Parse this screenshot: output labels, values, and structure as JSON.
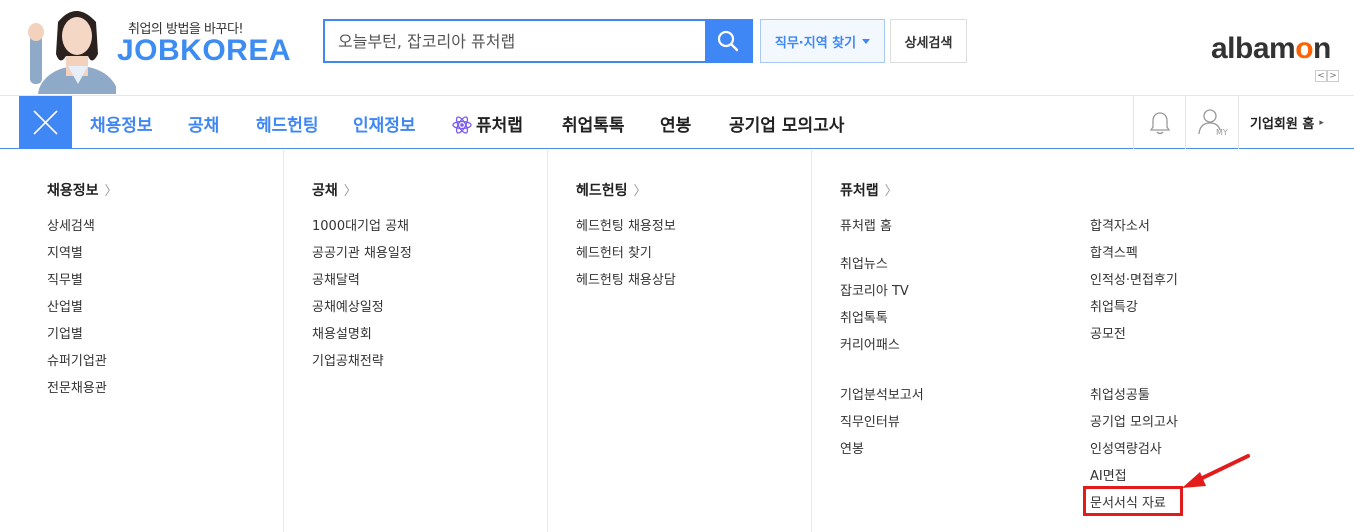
{
  "header": {
    "tagline": "취업의 방법을 바꾸다!",
    "logo": "JOBKOREA",
    "search_placeholder": "오늘부턴, 잡코리아 퓨처랩",
    "job_region_button": "직무·지역 찾기",
    "detail_search_button": "상세검색",
    "partner_logo_a": "albam",
    "partner_logo_b": "n",
    "slide_prev": "<",
    "slide_next": ">"
  },
  "nav": {
    "items": [
      "채용정보",
      "공채",
      "헤드헌팅",
      "인재정보",
      "퓨처랩",
      "취업톡톡",
      "연봉",
      "공기업 모의고사"
    ],
    "corp_home": "기업회원 홈",
    "my_label": "MY"
  },
  "menu": {
    "recruit": {
      "title": "채용정보",
      "links": [
        "상세검색",
        "지역별",
        "직무별",
        "산업별",
        "기업별",
        "슈퍼기업관",
        "전문채용관"
      ]
    },
    "public": {
      "title": "공채",
      "links": [
        "1000대기업 공채",
        "공공기관 채용일정",
        "공채달력",
        "공채예상일정",
        "채용설명회",
        "기업공채전략"
      ]
    },
    "headhunting": {
      "title": "헤드헌팅",
      "links": [
        "헤드헌팅 채용정보",
        "헤드헌터 찾기",
        "헤드헌팅 채용상담"
      ]
    },
    "futurelab": {
      "title": "퓨처랩",
      "left_links": [
        "퓨처랩 홈",
        "취업뉴스",
        "잡코리아 TV",
        "취업톡톡",
        "커리어패스",
        "기업분석보고서",
        "직무인터뷰",
        "연봉"
      ],
      "right_links": [
        "합격자소서",
        "합격스펙",
        "인적성·면접후기",
        "취업특강",
        "공모전",
        "취업성공툴",
        "공기업 모의고사",
        "인성역량검사",
        "AI면접",
        "문서서식 자료"
      ]
    }
  },
  "colors": {
    "brand_blue": "#3f87f5",
    "albamon_orange": "#ff6200",
    "highlight_red": "#e31b1b"
  }
}
